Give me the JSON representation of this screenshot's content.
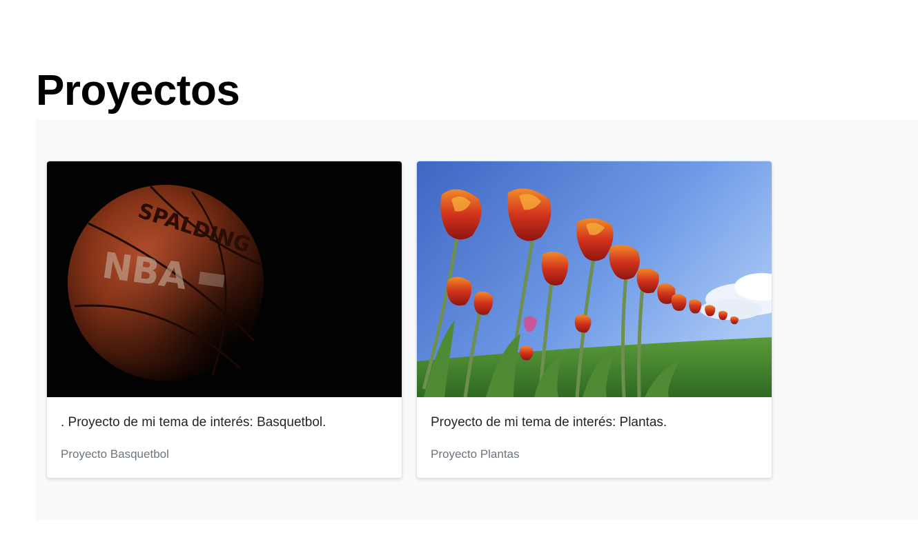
{
  "page": {
    "title": "Proyectos"
  },
  "projects": [
    {
      "image": "basketball-photo",
      "description": ". Proyecto de mi tema de interés: Basquetbol.",
      "caption": "Proyecto Basquetbol",
      "image_text": "SPALDING NBA"
    },
    {
      "image": "tulips-photo",
      "description": "Proyecto de mi tema de interés: Plantas.",
      "caption": "Proyecto Plantas"
    }
  ],
  "colors": {
    "section_bg": "#f8f9fa",
    "card_bg": "#ffffff",
    "caption_text": "#6c757d"
  }
}
